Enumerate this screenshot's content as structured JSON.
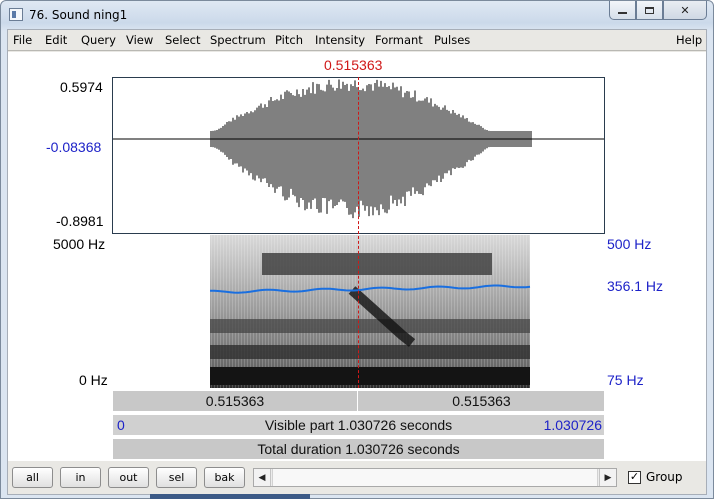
{
  "window": {
    "title": "76. Sound ning1",
    "min_glyph": "",
    "max_glyph": "",
    "close_glyph": "✕"
  },
  "menu": [
    "File",
    "Edit",
    "Query",
    "View",
    "Select",
    "Spectrum",
    "Pitch",
    "Intensity",
    "Formant",
    "Pulses",
    "Help"
  ],
  "cursor": {
    "time": "0.515363"
  },
  "waveform": {
    "max_label": "0.5974",
    "zero_label": "-0.08368",
    "min_label": "-0.8981"
  },
  "spectrogram": {
    "top_label": "5000 Hz",
    "bottom_label": "0 Hz",
    "pitch_top_label": "500 Hz",
    "pitch_value_label": "356.1 Hz",
    "pitch_bottom_label": "75 Hz"
  },
  "bars": {
    "left_time": "0.515363",
    "right_time": "0.515363",
    "visible_start": "0",
    "visible_text": "Visible part 1.030726 seconds",
    "visible_end": "1.030726",
    "total_text": "Total duration 1.030726 seconds"
  },
  "buttons": {
    "all": "all",
    "in": "in",
    "out": "out",
    "sel": "sel",
    "bak": "bak"
  },
  "scroll": {
    "left_arrow": "◀",
    "right_arrow": "▶"
  },
  "group": {
    "checked_mark": "✓",
    "label": "Group",
    "checked": true
  },
  "colors": {
    "cursor": "#d01818",
    "blue_labels": "#1d22c8",
    "pitch_line": "#1a6fe0"
  }
}
